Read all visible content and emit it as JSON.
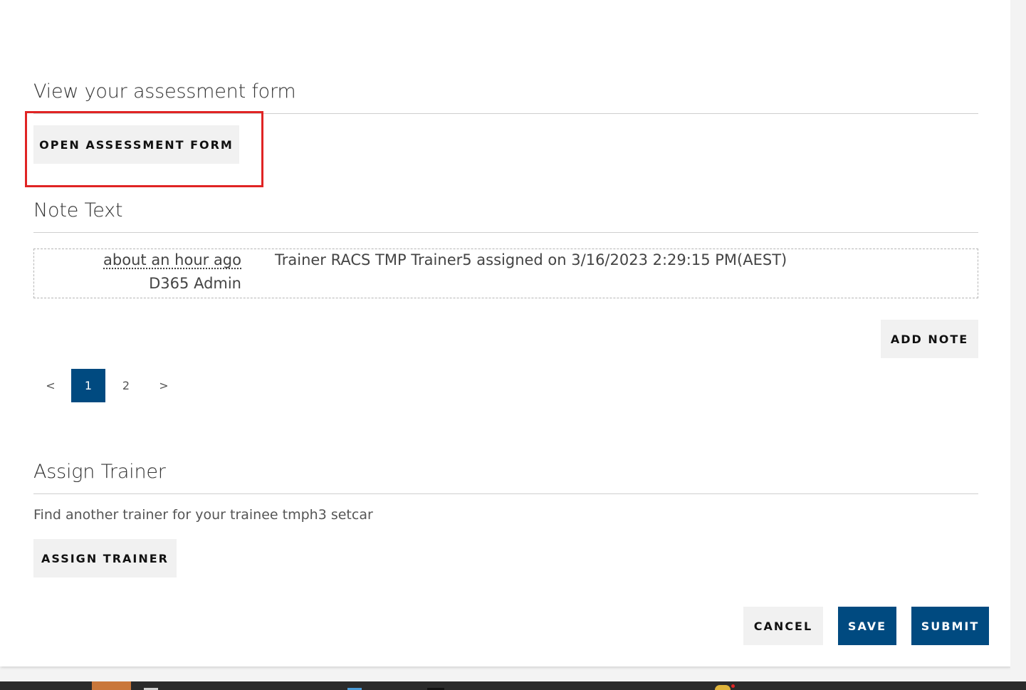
{
  "assessment": {
    "title": "View your assessment form",
    "open_button": "OPEN ASSESSMENT FORM"
  },
  "notes": {
    "title": "Note Text",
    "items": [
      {
        "time": "about an hour ago",
        "author": "D365 Admin",
        "text": "Trainer RACS TMP Trainer5 assigned on 3/16/2023 2:29:15 PM(AEST)"
      }
    ],
    "add_button": "ADD NOTE"
  },
  "pagination": {
    "prev": "<",
    "pages": [
      "1",
      "2"
    ],
    "current": "1",
    "next": ">"
  },
  "assign": {
    "title": "Assign Trainer",
    "helper": "Find another trainer for your trainee tmph3 setcar",
    "button": "ASSIGN TRAINER"
  },
  "actions": {
    "cancel": "CANCEL",
    "save": "SAVE",
    "submit": "SUBMIT"
  },
  "colors": {
    "primary": "#004a80",
    "highlight": "#e02424",
    "button_light": "#f1f1f1"
  }
}
